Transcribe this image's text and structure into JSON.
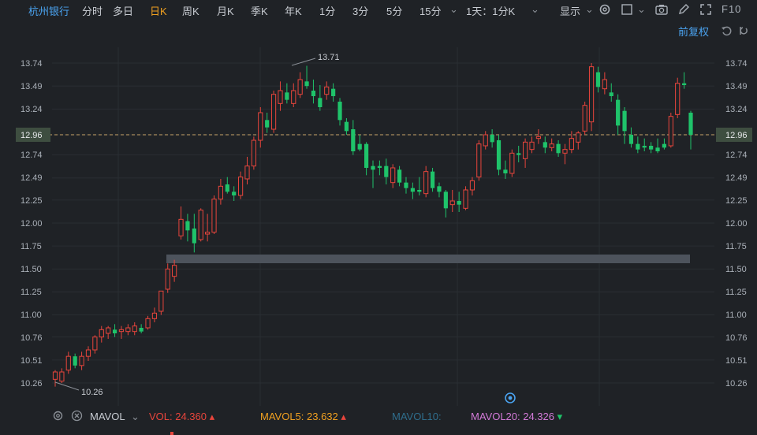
{
  "toolbar": {
    "stock_name": "杭州银行",
    "periods": [
      "分时",
      "多日",
      "日K",
      "周K",
      "月K",
      "季K",
      "年K",
      "1分",
      "3分",
      "5分",
      "15分",
      "1天：1分K"
    ],
    "active_period": "日K",
    "display_label": "显示",
    "f10_label": "F10"
  },
  "adjust_label": "前复权",
  "price_axis": {
    "ticks": [
      "13.74",
      "13.49",
      "13.24",
      "12.96",
      "12.74",
      "12.49",
      "12.25",
      "12.00",
      "11.75",
      "11.50",
      "11.25",
      "11.00",
      "10.76",
      "10.51",
      "10.26"
    ],
    "current_price": "12.96"
  },
  "annotations": {
    "high": "13.71",
    "low": "10.26"
  },
  "indicator_bar": {
    "name": "MAVOL",
    "vol": "VOL: 24.360",
    "mavol5": "MAVOL5: 23.632",
    "mavol10": "MAVOL10:",
    "mavol20": "MAVOL20: 24.326"
  },
  "colors": {
    "up": "#e8453c",
    "down": "#1fc36a",
    "accent": "#f0a020",
    "link": "#4aa3f0",
    "background": "#1f2226"
  },
  "chart_data": {
    "type": "candlestick",
    "y_range": [
      10.15,
      13.85
    ],
    "candles": [
      {
        "o": 10.3,
        "h": 10.4,
        "l": 10.22,
        "c": 10.38
      },
      {
        "o": 10.28,
        "h": 10.42,
        "l": 10.26,
        "c": 10.38
      },
      {
        "o": 10.4,
        "h": 10.6,
        "l": 10.36,
        "c": 10.55
      },
      {
        "o": 10.55,
        "h": 10.58,
        "l": 10.42,
        "c": 10.45
      },
      {
        "o": 10.45,
        "h": 10.6,
        "l": 10.4,
        "c": 10.55
      },
      {
        "o": 10.55,
        "h": 10.66,
        "l": 10.5,
        "c": 10.62
      },
      {
        "o": 10.62,
        "h": 10.78,
        "l": 10.58,
        "c": 10.76
      },
      {
        "o": 10.76,
        "h": 10.88,
        "l": 10.7,
        "c": 10.84
      },
      {
        "o": 10.8,
        "h": 10.88,
        "l": 10.74,
        "c": 10.86
      },
      {
        "o": 10.84,
        "h": 10.9,
        "l": 10.76,
        "c": 10.8
      },
      {
        "o": 10.82,
        "h": 10.88,
        "l": 10.74,
        "c": 10.84
      },
      {
        "o": 10.82,
        "h": 10.9,
        "l": 10.78,
        "c": 10.86
      },
      {
        "o": 10.82,
        "h": 10.92,
        "l": 10.78,
        "c": 10.88
      },
      {
        "o": 10.86,
        "h": 10.9,
        "l": 10.8,
        "c": 10.82
      },
      {
        "o": 10.86,
        "h": 10.99,
        "l": 10.84,
        "c": 10.96
      },
      {
        "o": 10.96,
        "h": 11.08,
        "l": 10.92,
        "c": 11.02
      },
      {
        "o": 11.04,
        "h": 11.26,
        "l": 11.0,
        "c": 11.26
      },
      {
        "o": 11.28,
        "h": 11.56,
        "l": 11.24,
        "c": 11.5
      },
      {
        "o": 11.42,
        "h": 11.6,
        "l": 11.36,
        "c": 11.54
      },
      {
        "o": 11.86,
        "h": 12.18,
        "l": 11.82,
        "c": 12.04
      },
      {
        "o": 12.02,
        "h": 12.1,
        "l": 11.8,
        "c": 11.92
      },
      {
        "o": 11.94,
        "h": 12.1,
        "l": 11.68,
        "c": 11.78
      },
      {
        "o": 11.82,
        "h": 12.16,
        "l": 11.8,
        "c": 12.14
      },
      {
        "o": 11.88,
        "h": 12.1,
        "l": 11.8,
        "c": 11.9
      },
      {
        "o": 11.9,
        "h": 12.3,
        "l": 11.88,
        "c": 12.26
      },
      {
        "o": 12.26,
        "h": 12.48,
        "l": 12.2,
        "c": 12.4
      },
      {
        "o": 12.42,
        "h": 12.5,
        "l": 12.32,
        "c": 12.34
      },
      {
        "o": 12.34,
        "h": 12.4,
        "l": 12.24,
        "c": 12.3
      },
      {
        "o": 12.3,
        "h": 12.56,
        "l": 12.26,
        "c": 12.5
      },
      {
        "o": 12.48,
        "h": 12.72,
        "l": 12.42,
        "c": 12.62
      },
      {
        "o": 12.62,
        "h": 12.94,
        "l": 12.58,
        "c": 12.9
      },
      {
        "o": 12.9,
        "h": 13.26,
        "l": 12.82,
        "c": 13.2
      },
      {
        "o": 13.12,
        "h": 13.2,
        "l": 12.98,
        "c": 13.04
      },
      {
        "o": 13.02,
        "h": 13.44,
        "l": 12.98,
        "c": 13.4
      },
      {
        "o": 13.3,
        "h": 13.54,
        "l": 13.22,
        "c": 13.44
      },
      {
        "o": 13.42,
        "h": 13.52,
        "l": 13.3,
        "c": 13.34
      },
      {
        "o": 13.3,
        "h": 13.52,
        "l": 13.26,
        "c": 13.44
      },
      {
        "o": 13.4,
        "h": 13.64,
        "l": 13.36,
        "c": 13.56
      },
      {
        "o": 13.54,
        "h": 13.71,
        "l": 13.46,
        "c": 13.49
      },
      {
        "o": 13.44,
        "h": 13.56,
        "l": 13.3,
        "c": 13.38
      },
      {
        "o": 13.36,
        "h": 13.5,
        "l": 13.22,
        "c": 13.26
      },
      {
        "o": 13.4,
        "h": 13.54,
        "l": 13.34,
        "c": 13.48
      },
      {
        "o": 13.46,
        "h": 13.52,
        "l": 13.32,
        "c": 13.38
      },
      {
        "o": 13.32,
        "h": 13.36,
        "l": 13.06,
        "c": 13.12
      },
      {
        "o": 13.1,
        "h": 13.14,
        "l": 12.96,
        "c": 13.0
      },
      {
        "o": 13.02,
        "h": 13.12,
        "l": 12.74,
        "c": 12.78
      },
      {
        "o": 12.86,
        "h": 12.96,
        "l": 12.78,
        "c": 12.8
      },
      {
        "o": 12.86,
        "h": 12.88,
        "l": 12.52,
        "c": 12.6
      },
      {
        "o": 12.62,
        "h": 12.68,
        "l": 12.38,
        "c": 12.58
      },
      {
        "o": 12.62,
        "h": 12.68,
        "l": 12.52,
        "c": 12.6
      },
      {
        "o": 12.62,
        "h": 12.7,
        "l": 12.42,
        "c": 12.5
      },
      {
        "o": 12.44,
        "h": 12.64,
        "l": 12.38,
        "c": 12.6
      },
      {
        "o": 12.58,
        "h": 12.62,
        "l": 12.4,
        "c": 12.44
      },
      {
        "o": 12.44,
        "h": 12.5,
        "l": 12.32,
        "c": 12.38
      },
      {
        "o": 12.38,
        "h": 12.44,
        "l": 12.26,
        "c": 12.34
      },
      {
        "o": 12.36,
        "h": 12.5,
        "l": 12.3,
        "c": 12.34
      },
      {
        "o": 12.32,
        "h": 12.62,
        "l": 12.28,
        "c": 12.56
      },
      {
        "o": 12.56,
        "h": 12.6,
        "l": 12.34,
        "c": 12.38
      },
      {
        "o": 12.4,
        "h": 12.44,
        "l": 12.28,
        "c": 12.34
      },
      {
        "o": 12.34,
        "h": 12.36,
        "l": 12.06,
        "c": 12.16
      },
      {
        "o": 12.2,
        "h": 12.36,
        "l": 12.12,
        "c": 12.24
      },
      {
        "o": 12.24,
        "h": 12.34,
        "l": 12.12,
        "c": 12.2
      },
      {
        "o": 12.16,
        "h": 12.4,
        "l": 12.14,
        "c": 12.36
      },
      {
        "o": 12.36,
        "h": 12.5,
        "l": 12.3,
        "c": 12.46
      },
      {
        "o": 12.5,
        "h": 12.9,
        "l": 12.46,
        "c": 12.86
      },
      {
        "o": 12.84,
        "h": 13.0,
        "l": 12.8,
        "c": 12.96
      },
      {
        "o": 12.96,
        "h": 13.02,
        "l": 12.82,
        "c": 12.88
      },
      {
        "o": 12.9,
        "h": 12.96,
        "l": 12.52,
        "c": 12.58
      },
      {
        "o": 12.58,
        "h": 12.68,
        "l": 12.48,
        "c": 12.54
      },
      {
        "o": 12.54,
        "h": 12.8,
        "l": 12.5,
        "c": 12.76
      },
      {
        "o": 12.76,
        "h": 12.84,
        "l": 12.66,
        "c": 12.74
      },
      {
        "o": 12.7,
        "h": 12.92,
        "l": 12.6,
        "c": 12.88
      },
      {
        "o": 12.8,
        "h": 12.94,
        "l": 12.76,
        "c": 12.88
      },
      {
        "o": 12.92,
        "h": 13.02,
        "l": 12.86,
        "c": 12.94
      },
      {
        "o": 12.88,
        "h": 12.94,
        "l": 12.76,
        "c": 12.82
      },
      {
        "o": 12.82,
        "h": 12.92,
        "l": 12.78,
        "c": 12.86
      },
      {
        "o": 12.86,
        "h": 12.9,
        "l": 12.72,
        "c": 12.76
      },
      {
        "o": 12.76,
        "h": 12.86,
        "l": 12.64,
        "c": 12.8
      },
      {
        "o": 12.8,
        "h": 13.0,
        "l": 12.76,
        "c": 12.92
      },
      {
        "o": 12.88,
        "h": 13.0,
        "l": 12.8,
        "c": 12.98
      },
      {
        "o": 13.0,
        "h": 13.32,
        "l": 12.96,
        "c": 13.28
      },
      {
        "o": 13.1,
        "h": 13.74,
        "l": 13.0,
        "c": 13.7
      },
      {
        "o": 13.64,
        "h": 13.7,
        "l": 13.42,
        "c": 13.48
      },
      {
        "o": 13.46,
        "h": 13.64,
        "l": 13.4,
        "c": 13.56
      },
      {
        "o": 13.42,
        "h": 13.52,
        "l": 13.32,
        "c": 13.38
      },
      {
        "o": 13.34,
        "h": 13.4,
        "l": 12.96,
        "c": 13.06
      },
      {
        "o": 13.22,
        "h": 13.26,
        "l": 12.86,
        "c": 13.0
      },
      {
        "o": 12.96,
        "h": 13.04,
        "l": 12.82,
        "c": 12.86
      },
      {
        "o": 12.86,
        "h": 12.94,
        "l": 12.76,
        "c": 12.8
      },
      {
        "o": 12.84,
        "h": 12.92,
        "l": 12.78,
        "c": 12.82
      },
      {
        "o": 12.84,
        "h": 12.88,
        "l": 12.76,
        "c": 12.8
      },
      {
        "o": 12.82,
        "h": 12.92,
        "l": 12.76,
        "c": 12.78
      },
      {
        "o": 12.86,
        "h": 12.92,
        "l": 12.8,
        "c": 12.82
      },
      {
        "o": 12.84,
        "h": 13.2,
        "l": 12.82,
        "c": 13.16
      },
      {
        "o": 13.18,
        "h": 13.58,
        "l": 13.14,
        "c": 13.52
      },
      {
        "o": 13.52,
        "h": 13.64,
        "l": 13.46,
        "c": 13.5
      },
      {
        "o": 13.2,
        "h": 13.22,
        "l": 12.8,
        "c": 12.96
      }
    ]
  }
}
